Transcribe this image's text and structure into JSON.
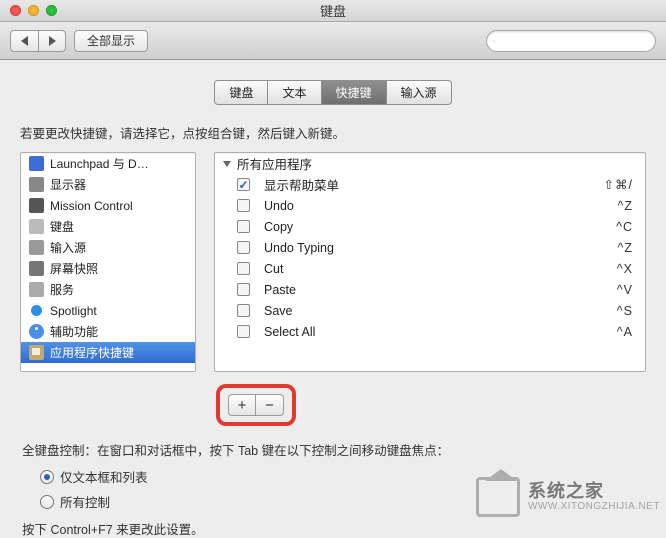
{
  "window": {
    "title": "键盘"
  },
  "toolbar": {
    "show_all": "全部显示",
    "search_placeholder": ""
  },
  "tabs": [
    {
      "label": "键盘"
    },
    {
      "label": "文本"
    },
    {
      "label": "快捷键"
    },
    {
      "label": "输入源"
    }
  ],
  "active_tab": 2,
  "instruction": "若要更改快捷键，请选择它，点按组合键，然后键入新键。",
  "categories": [
    {
      "label": "Launchpad 与 D…",
      "icon": "launchpad"
    },
    {
      "label": "显示器",
      "icon": "display"
    },
    {
      "label": "Mission Control",
      "icon": "mission"
    },
    {
      "label": "键盘",
      "icon": "keyboard"
    },
    {
      "label": "输入源",
      "icon": "input"
    },
    {
      "label": "屏幕快照",
      "icon": "screenshot"
    },
    {
      "label": "服务",
      "icon": "services"
    },
    {
      "label": "Spotlight",
      "icon": "spotlight"
    },
    {
      "label": "辅助功能",
      "icon": "accessibility"
    },
    {
      "label": "应用程序快捷键",
      "icon": "appshortcut"
    }
  ],
  "selected_category": 9,
  "shortcuts": {
    "group_label": "所有应用程序",
    "items": [
      {
        "enabled": true,
        "label": "显示帮助菜单",
        "key": "⇧⌘/"
      },
      {
        "enabled": false,
        "label": "Undo",
        "key": "^Z"
      },
      {
        "enabled": false,
        "label": "Copy",
        "key": "^C"
      },
      {
        "enabled": false,
        "label": "Undo Typing",
        "key": "^Z"
      },
      {
        "enabled": false,
        "label": "Cut",
        "key": "^X"
      },
      {
        "enabled": false,
        "label": "Paste",
        "key": "^V"
      },
      {
        "enabled": false,
        "label": "Save",
        "key": "^S"
      },
      {
        "enabled": false,
        "label": "Select All",
        "key": "^A"
      }
    ]
  },
  "buttons": {
    "add": "+",
    "remove": "−"
  },
  "fka": {
    "title": "全键盘控制：在窗口和对话框中，按下 Tab 键在以下控制之间移动键盘焦点：",
    "opt1": "仅文本框和列表",
    "opt2": "所有控制",
    "selected": 0,
    "hint": "按下 Control+F7 来更改此设置。"
  },
  "watermark": {
    "cn": "系统之家",
    "en": "WWW.XITONGZHIJIA.NET"
  }
}
